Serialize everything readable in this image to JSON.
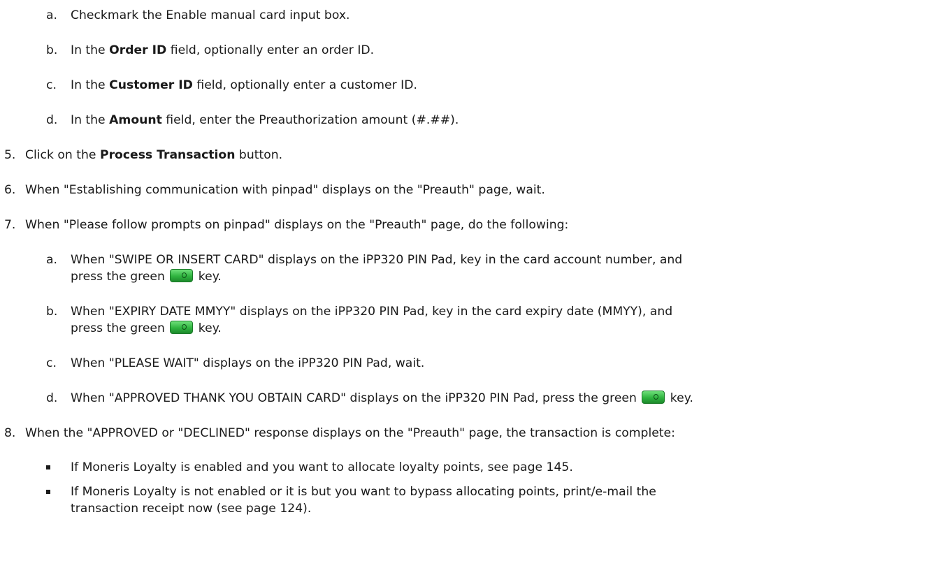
{
  "steps": {
    "s4a": {
      "marker": "a.",
      "pre": "Checkmark the Enable manual card input box."
    },
    "s4b": {
      "marker": "b.",
      "pre": "In the ",
      "bold": "Order ID",
      "post": " field, optionally enter an order ID."
    },
    "s4c": {
      "marker": "c.",
      "pre": "In the ",
      "bold": "Customer ID",
      "post": " field, optionally enter a customer ID."
    },
    "s4d": {
      "marker": "d.",
      "pre": "In the ",
      "bold": "Amount",
      "post": " field, enter the Preauthorization amount (#.##)."
    },
    "s5": {
      "marker": "5.",
      "pre": "Click on the ",
      "bold": "Process Transaction",
      "post": " button."
    },
    "s6": {
      "marker": "6.",
      "pre": "When \"Establishing communication with pinpad\" displays on the \"Preauth\" page, wait."
    },
    "s7": {
      "marker": "7.",
      "pre": "When \"Please follow prompts on pinpad\" displays on the \"Preauth\" page, do the following:"
    },
    "s7a": {
      "marker": "a.",
      "pre": "When \"SWIPE OR INSERT CARD\" displays on the iPP320 PIN Pad, key in the card account number, and",
      "line2_pre": "press the green ",
      "line2_post": " key."
    },
    "s7b": {
      "marker": "b.",
      "pre": "When \"EXPIRY DATE MMYY\" displays on the iPP320 PIN Pad, key in the card expiry date (MMYY), and",
      "line2_pre": "press the green ",
      "line2_post": " key."
    },
    "s7c": {
      "marker": "c.",
      "pre": "When \"PLEASE WAIT\" displays on the iPP320 PIN Pad, wait."
    },
    "s7d": {
      "marker": "d.",
      "pre": "When \"APPROVED THANK YOU OBTAIN CARD\" displays on the iPP320 PIN Pad, press the green ",
      "post": " key."
    },
    "s8": {
      "marker": "8.",
      "pre": "When the \"APPROVED or \"DECLINED\" response displays on the \"Preauth\" page, the transaction is complete:"
    },
    "b1": {
      "pre": "If Moneris Loyalty is enabled and you want to allocate loyalty points, see page 145."
    },
    "b2": {
      "pre": "If Moneris Loyalty is not enabled or it is but you want to bypass allocating points, print/e-mail the",
      "line2": "transaction receipt now (see page 124)."
    }
  },
  "icons": {
    "key": "green-ok-key-icon",
    "bullet": "square-bullet-icon"
  },
  "colors": {
    "key_green": "#2fb43f",
    "text": "#1a1a1a"
  }
}
